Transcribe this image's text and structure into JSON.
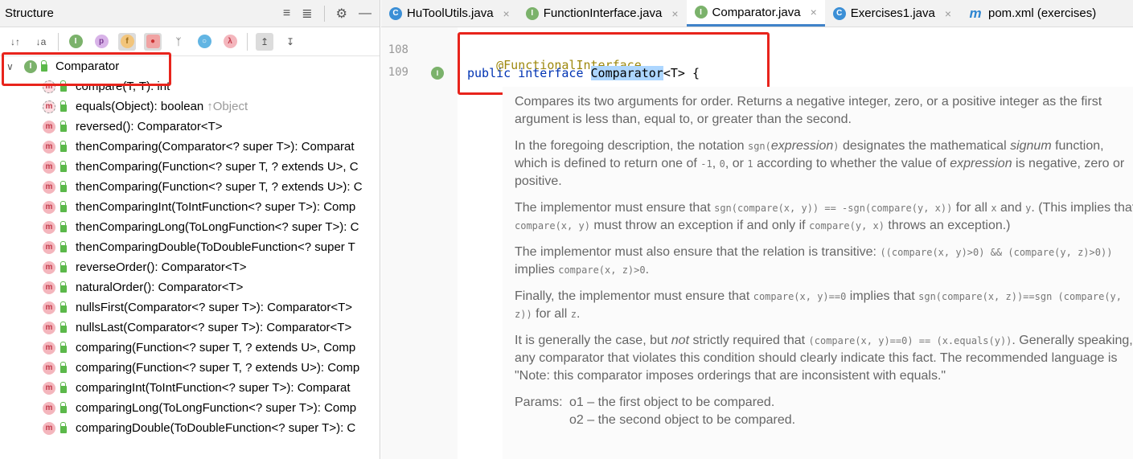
{
  "structure": {
    "title": "Structure",
    "root": {
      "label": "Comparator",
      "icon": "interface-icon"
    },
    "methods": [
      {
        "label": "compare(T, T): int",
        "abstract": true,
        "inherited": ""
      },
      {
        "label": "equals(Object): boolean",
        "abstract": true,
        "inherited": "↑Object"
      },
      {
        "label": "reversed(): Comparator<T>",
        "abstract": false,
        "inherited": ""
      },
      {
        "label": "thenComparing(Comparator<? super T>): Comparat",
        "abstract": false,
        "inherited": ""
      },
      {
        "label": "thenComparing(Function<? super T, ? extends U>, C",
        "abstract": false,
        "inherited": ""
      },
      {
        "label": "thenComparing(Function<? super T, ? extends U>): C",
        "abstract": false,
        "inherited": ""
      },
      {
        "label": "thenComparingInt(ToIntFunction<? super T>): Comp",
        "abstract": false,
        "inherited": ""
      },
      {
        "label": "thenComparingLong(ToLongFunction<? super T>): C",
        "abstract": false,
        "inherited": ""
      },
      {
        "label": "thenComparingDouble(ToDoubleFunction<? super T",
        "abstract": false,
        "inherited": ""
      },
      {
        "label": "reverseOrder(): Comparator<T>",
        "abstract": false,
        "inherited": ""
      },
      {
        "label": "naturalOrder(): Comparator<T>",
        "abstract": false,
        "inherited": ""
      },
      {
        "label": "nullsFirst(Comparator<? super T>): Comparator<T>",
        "abstract": false,
        "inherited": ""
      },
      {
        "label": "nullsLast(Comparator<? super T>): Comparator<T>",
        "abstract": false,
        "inherited": ""
      },
      {
        "label": "comparing(Function<? super T, ? extends U>, Comp",
        "abstract": false,
        "inherited": ""
      },
      {
        "label": "comparing(Function<? super T, ? extends U>): Comp",
        "abstract": false,
        "inherited": ""
      },
      {
        "label": "comparingInt(ToIntFunction<? super T>): Comparat",
        "abstract": false,
        "inherited": ""
      },
      {
        "label": "comparingLong(ToLongFunction<? super T>): Comp",
        "abstract": false,
        "inherited": ""
      },
      {
        "label": "comparingDouble(ToDoubleFunction<? super T>): C",
        "abstract": false,
        "inherited": ""
      }
    ]
  },
  "tabs": [
    {
      "label": "HuToolUtils.java",
      "icon": "class-icon",
      "active": false
    },
    {
      "label": "FunctionInterface.java",
      "icon": "interface-icon",
      "active": false
    },
    {
      "label": "Comparator.java",
      "icon": "interface-icon",
      "active": true
    },
    {
      "label": "Exercises1.java",
      "icon": "class-icon",
      "active": false
    },
    {
      "label": "pom.xml (exercises)",
      "icon": "maven-icon",
      "active": false
    }
  ],
  "editor": {
    "line1_no": "108",
    "line2_no": "109",
    "annotation": "@FunctionalInterface",
    "kw_public": "public",
    "kw_interface": "interface",
    "class_name": "Comparator",
    "signature_rest": "<T> {"
  },
  "doc": {
    "p1": "Compares its two arguments for order. Returns a negative integer, zero, or a positive integer as the first argument is less than, equal to, or greater than the second.",
    "p2a": "In the foregoing description, the notation ",
    "p2_sgn": "sgn(",
    "p2_expr": "expression",
    "p2_close": ")",
    "p2b": " designates the mathematical ",
    "p2_signum": "signum",
    "p2c": " function, which is defined to return one of ",
    "p2_m1": "-1",
    "p2_comma1": ", ",
    "p2_0": "0",
    "p2_or": ", or ",
    "p2_1": "1",
    "p2d": " according to whether the value of ",
    "p2_expr2": "expression",
    "p2e": " is negative, zero or positive.",
    "p3a": "The implementor must ensure that ",
    "p3_code1": "sgn(compare(x, y)) == -sgn(compare(y, x))",
    "p3b": " for all ",
    "p3_x": "x",
    "p3_and": " and ",
    "p3_y": "y",
    "p3c": ". (This implies that ",
    "p3_code2": "compare(x, y)",
    "p3d": " must throw an exception if and only if ",
    "p3_code3": "compare(y, x)",
    "p3e": " throws an exception.)",
    "p4a": "The implementor must also ensure that the relation is transitive: ",
    "p4_code1": "((compare(x, y)>0) && (compare(y, z)>0))",
    "p4b": " implies ",
    "p4_code2": "compare(x, z)>0",
    "p4c": ".",
    "p5a": "Finally, the implementor must ensure that ",
    "p5_code1": "compare(x, y)==0",
    "p5b": " implies that ",
    "p5_code2": "sgn(compare(x, z))==sgn (compare(y, z))",
    "p5c": " for all ",
    "p5_z": "z",
    "p5d": ".",
    "p6a": "It is generally the case, but ",
    "p6_not": "not",
    "p6b": " strictly required that ",
    "p6_code1": "(compare(x, y)==0) == (x.equals(y))",
    "p6c": ". Generally speaking, any comparator that violates this condition should clearly indicate this fact. The recommended language is \"Note: this comparator imposes orderings that are inconsistent with equals.\"",
    "params_label": "Params:",
    "param1": "o1 – the first object to be compared.",
    "param2": "o2 – the second object to be compared."
  }
}
